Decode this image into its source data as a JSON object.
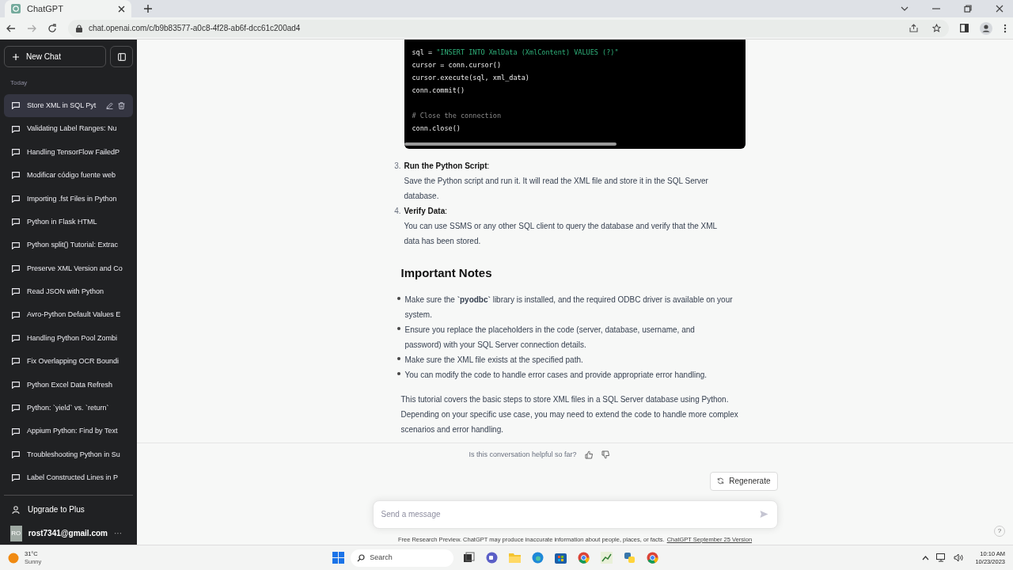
{
  "browser": {
    "tab_title": "ChatGPT",
    "url": "chat.openai.com/c/b9b83577-a0c8-4f28-ab6f-dcc61c200ad4"
  },
  "sidebar": {
    "new_chat": "New Chat",
    "section": "Today",
    "items": [
      {
        "title": "Store XML in SQL Pyt",
        "selected": true
      },
      {
        "title": "Validating Label Ranges: Nu",
        "selected": false
      },
      {
        "title": "Handling TensorFlow FailedP",
        "selected": false
      },
      {
        "title": "Modificar código fuente web",
        "selected": false
      },
      {
        "title": "Importing .fst Files in Python",
        "selected": false
      },
      {
        "title": "Python in Flask HTML",
        "selected": false
      },
      {
        "title": "Python split() Tutorial: Extrac",
        "selected": false
      },
      {
        "title": "Preserve XML Version and Co",
        "selected": false
      },
      {
        "title": "Read JSON with Python",
        "selected": false
      },
      {
        "title": "Avro-Python Default Values E",
        "selected": false
      },
      {
        "title": "Handling Python Pool Zombi",
        "selected": false
      },
      {
        "title": "Fix Overlapping OCR Boundi",
        "selected": false
      },
      {
        "title": "Python Excel Data Refresh",
        "selected": false
      },
      {
        "title": "Python: `yield` vs. `return`",
        "selected": false
      },
      {
        "title": "Appium Python: Find by Text",
        "selected": false
      },
      {
        "title": "Troubleshooting Python in Su",
        "selected": false
      },
      {
        "title": "Label Constructed Lines in P",
        "selected": false
      }
    ],
    "upgrade": "Upgrade to Plus",
    "avatar": "RO",
    "email": "rost7341@gmail.com",
    "more": "···"
  },
  "code_lines": [
    {
      "tokens": [
        {
          "kind": "plain",
          "text": "sql = "
        },
        {
          "kind": "string",
          "text": "\"INSERT INTO XmlData (XmlContent) VALUES (?)\""
        }
      ]
    },
    {
      "tokens": [
        {
          "kind": "plain",
          "text": "cursor = conn.cursor()"
        }
      ]
    },
    {
      "tokens": [
        {
          "kind": "plain",
          "text": "cursor.execute(sql, xml_data)"
        }
      ]
    },
    {
      "tokens": [
        {
          "kind": "plain",
          "text": "conn.commit()"
        }
      ]
    },
    {
      "blank_line_before": true,
      "tokens": [
        {
          "kind": "comment",
          "text": "# Close the connection"
        }
      ]
    },
    {
      "tokens": [
        {
          "kind": "plain",
          "text": "conn.close()"
        }
      ]
    }
  ],
  "steps": [
    {
      "number": "3.",
      "title": "Run the Python Script",
      "colon": ":",
      "text": "Save the Python script and run it. It will read the XML file and store it in the SQL Server database."
    },
    {
      "number": "4.",
      "title": "Verify Data",
      "colon": ":",
      "text": "You can use SSMS or any other SQL client to query the database and verify that the XML data has been stored."
    }
  ],
  "heading": "Important Notes",
  "notes": [
    "Make sure the **`pyodbc`** library is installed, and the required ODBC driver is available on your system.",
    "Ensure you replace the placeholders in the code (server, database, username, and password) with your SQL Server connection details.",
    "Make sure the XML file exists at the specified path.",
    "You can modify the code to handle error cases and provide appropriate error handling."
  ],
  "summary": "This tutorial covers the basic steps to store XML files in a SQL Server database using Python. Depending on your specific use case, you may need to extend the code to handle more complex scenarios and error handling.",
  "feedback": "Is this conversation helpful so far?",
  "regenerate": "Regenerate",
  "composer": {
    "placeholder": "Send a message"
  },
  "disclaimer": "Free Research Preview. ChatGPT may produce inaccurate information about people, places, or facts.",
  "version_link": "ChatGPT September 25 Version",
  "help": "?",
  "taskbar": {
    "temperature": "31°C",
    "weather": "Sunny",
    "search": "Search",
    "time": "10:10 AM",
    "date": "10/23/2023"
  }
}
